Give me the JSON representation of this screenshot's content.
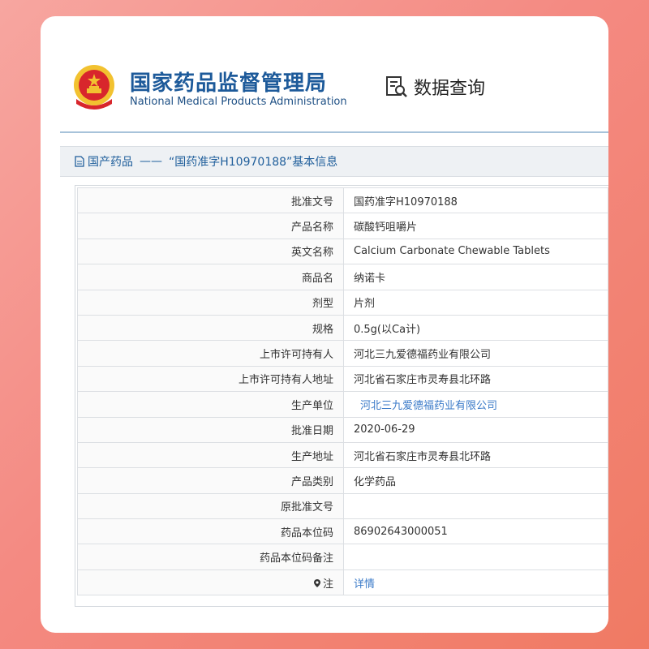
{
  "header": {
    "agency_cn": "国家药品监督管理局",
    "agency_en": "National Medical Products Administration",
    "query_label": "数据查询"
  },
  "section": {
    "category": "国产药品",
    "separator": "——",
    "title": "“国药准字H10970188”基本信息"
  },
  "rows": [
    {
      "label": "批准文号",
      "value": "国药准字H10970188"
    },
    {
      "label": "产品名称",
      "value": "碳酸钙咀嚼片"
    },
    {
      "label": "英文名称",
      "value": "Calcium Carbonate Chewable Tablets"
    },
    {
      "label": "商品名",
      "value": "纳诺卡"
    },
    {
      "label": "剂型",
      "value": "片剂"
    },
    {
      "label": "规格",
      "value": "0.5g(以Ca计)"
    },
    {
      "label": "上市许可持有人",
      "value": "河北三九爱德福药业有限公司"
    },
    {
      "label": "上市许可持有人地址",
      "value": "河北省石家庄市灵寿县北环路"
    },
    {
      "label": "生产单位",
      "value": "河北三九爱德福药业有限公司"
    },
    {
      "label": "批准日期",
      "value": "2020-06-29"
    },
    {
      "label": "生产地址",
      "value": "河北省石家庄市灵寿县北环路"
    },
    {
      "label": "产品类别",
      "value": "化学药品"
    },
    {
      "label": "原批准文号",
      "value": ""
    },
    {
      "label": "药品本位码",
      "value": "86902643000051"
    },
    {
      "label": "药品本位码备注",
      "value": ""
    },
    {
      "label": "注",
      "value": "详情"
    }
  ],
  "colors": {
    "brand_blue": "#1d5a9a",
    "link_blue": "#3a7ac8",
    "emblem_red": "#d8262c",
    "emblem_gold": "#f2c230"
  }
}
